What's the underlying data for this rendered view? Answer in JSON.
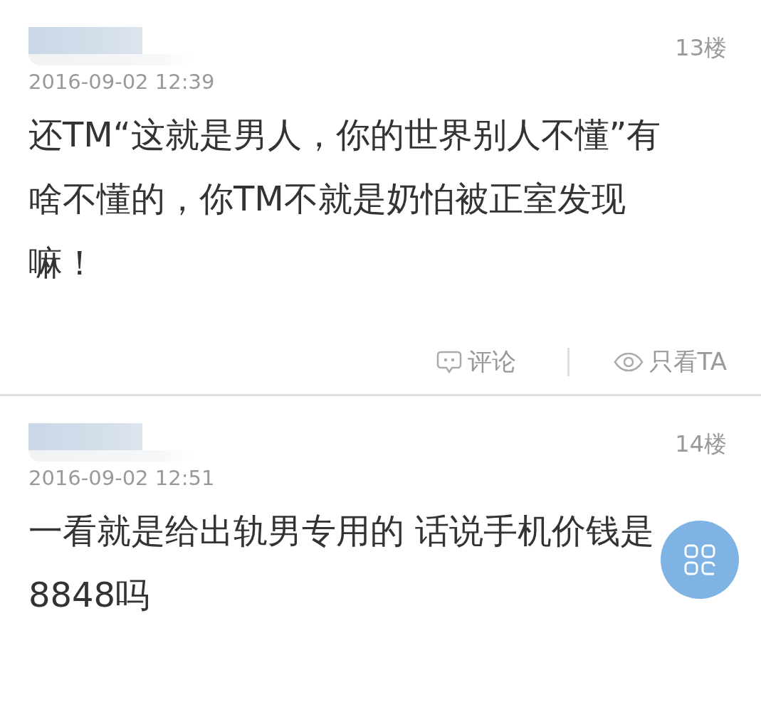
{
  "posts": [
    {
      "floor": "13楼",
      "date": "2016-09-02 12:39",
      "text": "还TM“这就是男人，你的世界别人不懂”有啥不懂的，你TM不就是奶怕被正室发现嘛！",
      "actions": [
        {
          "kind": "comment",
          "label": "评论"
        },
        {
          "kind": "view",
          "label": "只看TA"
        }
      ]
    },
    {
      "floor": "14楼",
      "date": "2016-09-02 12:51",
      "text": "一看就是给出轨男专用的 话说手机价钱是8848吗"
    }
  ]
}
